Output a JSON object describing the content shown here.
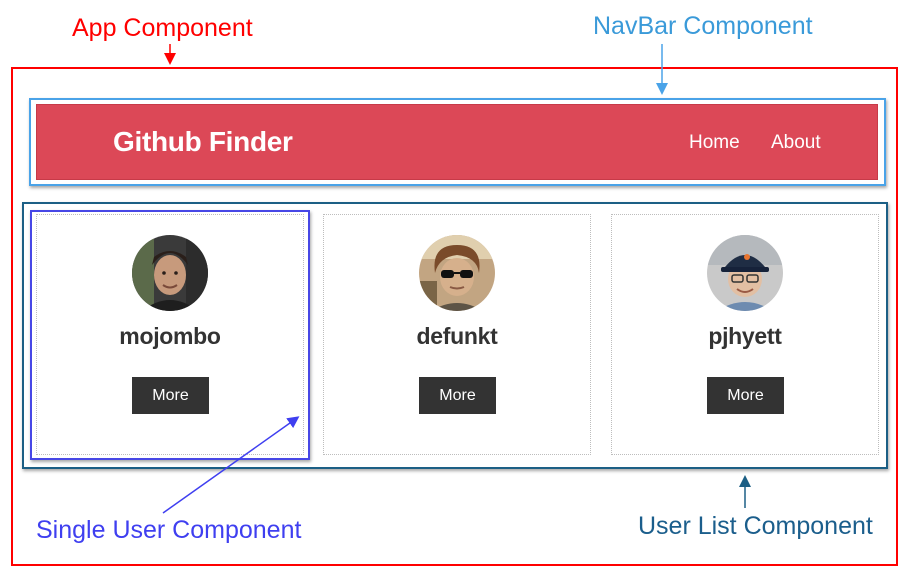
{
  "annotations": {
    "app_component": "App Component",
    "navbar_component": "NavBar Component",
    "single_user_component": "Single User Component",
    "user_list_component": "User List Component"
  },
  "navbar": {
    "brand": "Github Finder",
    "links": [
      "Home",
      "About"
    ],
    "background": "#dc4857"
  },
  "users": [
    {
      "login": "mojombo",
      "button": "More"
    },
    {
      "login": "defunkt",
      "button": "More"
    },
    {
      "login": "pjhyett",
      "button": "More"
    }
  ],
  "colors": {
    "app_component": "#ff0000",
    "navbar_component": "#4aa3e8",
    "single_user_component": "#4747e6",
    "user_list_component": "#1c5f85"
  }
}
